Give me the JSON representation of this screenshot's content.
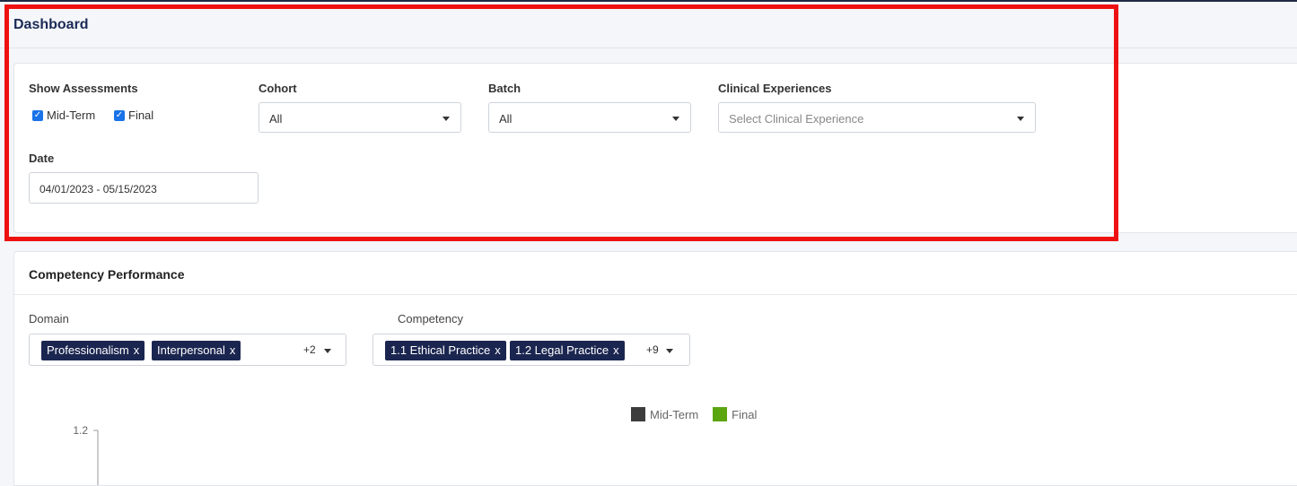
{
  "header": {
    "title": "Dashboard"
  },
  "filters": {
    "show_assessments": {
      "label": "Show Assessments",
      "options": [
        {
          "label": "Mid-Term",
          "checked": true
        },
        {
          "label": "Final",
          "checked": true
        }
      ]
    },
    "cohort": {
      "label": "Cohort",
      "value": "All"
    },
    "batch": {
      "label": "Batch",
      "value": "All"
    },
    "clinical_experiences": {
      "label": "Clinical Experiences",
      "placeholder": "Select Clinical Experience"
    },
    "date": {
      "label": "Date",
      "value": "04/01/2023 - 05/15/2023"
    }
  },
  "performance": {
    "title": "Competency Performance",
    "domain": {
      "label": "Domain",
      "tags": [
        "Professionalism",
        "Interpersonal"
      ],
      "more": "+2"
    },
    "competency": {
      "label": "Competency",
      "tags": [
        "1.1 Ethical Practice",
        "1.2 Legal Practice"
      ],
      "more": "+9"
    },
    "tag_remove": "x"
  },
  "chart_data": {
    "type": "bar",
    "categories": [],
    "series": [
      {
        "name": "Mid-Term",
        "color": "#3d3d3d",
        "values": []
      },
      {
        "name": "Final",
        "color": "#5ba511",
        "values": []
      }
    ],
    "y_ticks": [
      "1.2"
    ],
    "legend_position": "top-center"
  },
  "colors": {
    "highlight_border": "#ee1111",
    "tag_background": "#1b2650",
    "checkbox": "#1a73e8"
  }
}
